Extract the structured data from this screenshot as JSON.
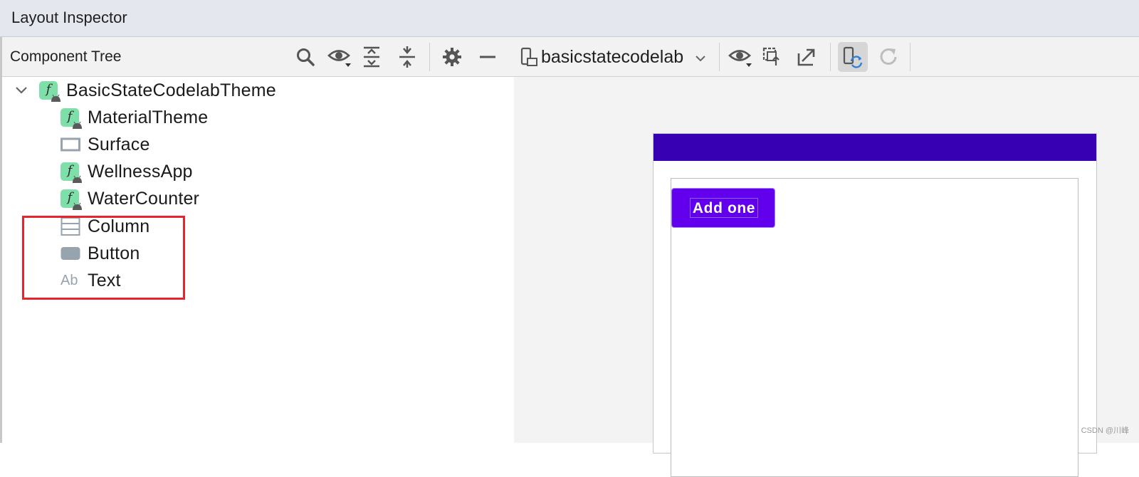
{
  "window": {
    "title": "Layout Inspector"
  },
  "component_tree": {
    "title": "Component Tree",
    "toolbar_icons": [
      "search-icon",
      "eye-icon",
      "expand-all-icon",
      "collapse-all-icon",
      "gear-icon",
      "minimize-icon"
    ],
    "nodes": [
      {
        "label": "BasicStateCodelabTheme",
        "icon": "compose-function-icon",
        "expanded": true
      },
      {
        "label": "MaterialTheme",
        "icon": "compose-function-icon"
      },
      {
        "label": "Surface",
        "icon": "surface-icon"
      },
      {
        "label": "WellnessApp",
        "icon": "compose-function-icon"
      },
      {
        "label": "WaterCounter",
        "icon": "compose-function-icon"
      },
      {
        "label": "Column",
        "icon": "column-icon"
      },
      {
        "label": "Button",
        "icon": "button-icon"
      },
      {
        "label": "Text",
        "icon": "text-icon",
        "icon_text": "Ab"
      }
    ],
    "highlighted_nodes": [
      "Column",
      "Button",
      "Text"
    ]
  },
  "inspector_toolbar": {
    "process": "basicstatecodelab",
    "icons": [
      "device-icon",
      "chevron-down-icon",
      "eye-icon",
      "snapshot-icon",
      "export-icon",
      "live-updates-icon",
      "refresh-icon"
    ],
    "live_updates_active": true
  },
  "device_preview": {
    "app_bar_color": "#3700b3",
    "button": {
      "label": "Add one",
      "color": "#6200ee"
    }
  },
  "colors": {
    "highlight": "#e8242c",
    "compose_badge": "#7ee0a8",
    "title_bar": "#e4e7ee"
  },
  "watermark": "CSDN @川峰"
}
